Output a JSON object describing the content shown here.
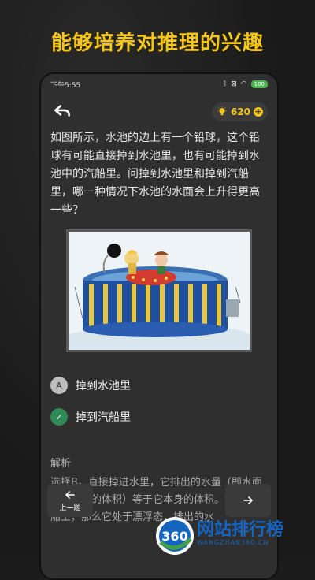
{
  "promo": {
    "title": "能够培养对推理的兴趣"
  },
  "status": {
    "time": "下午5:55",
    "battery": "100"
  },
  "header": {
    "score": "620"
  },
  "question": {
    "text": "如图所示，水池的边上有一个铅球，这个铅球有可能直接掉到水池里，也有可能掉到水池中的汽船里。问掉到水池里和掉到汽船里，哪一种情况下水池的水面会上升得更高一些？"
  },
  "options": [
    {
      "badge": "A",
      "label": "掉到水池里"
    },
    {
      "badge": "✓",
      "label": "掉到汽船里"
    }
  ],
  "analysis": {
    "title": "解析",
    "text": "选择B。直接掉进水里，它排出的水量（即水面上升部分的体积）等于它本身的体积。如果落到船上，那么它处于漂浮态，排出的水"
  },
  "nav": {
    "prev_label": "上一题"
  },
  "watermark": {
    "brand_cn": "网站排行榜",
    "brand_en": "WANGZHAN360.CN",
    "logo": "360"
  },
  "icons": {
    "back": "back-arrow-icon",
    "bulb": "bulb-icon",
    "plus": "plus-icon",
    "prev": "arrow-left-icon",
    "next": "arrow-right-icon"
  }
}
